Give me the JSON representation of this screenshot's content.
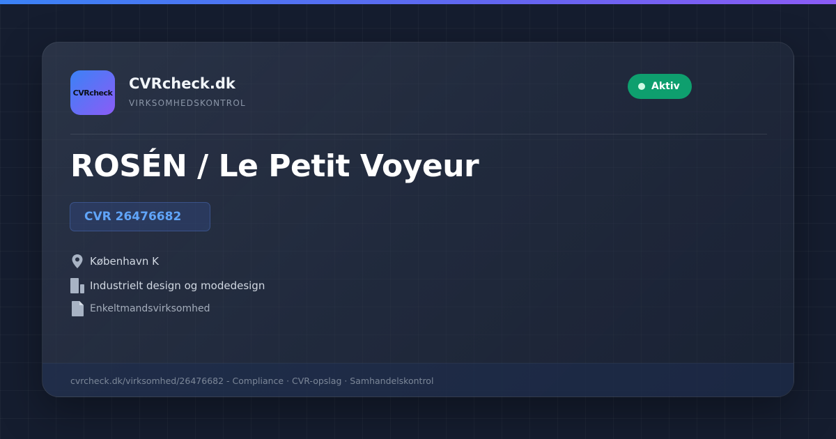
{
  "brand": {
    "logo_text": "CVRcheck",
    "name": "CVRcheck.dk",
    "subtitle": "VIRKSOMHEDSKONTROL"
  },
  "status": {
    "label": "Aktiv",
    "color": "#0e9f6e"
  },
  "company": {
    "name": "ROSÉN / Le Petit Voyeur",
    "cvr_label": "CVR 26476682"
  },
  "details": {
    "location": {
      "icon": "location-pin-icon",
      "text": "København K"
    },
    "industry": {
      "icon": "building-icon",
      "text": "Industrielt design og modedesign"
    },
    "company_type": {
      "icon": "document-icon",
      "text": "Enkeltmandsvirksomhed"
    }
  },
  "footer": {
    "text": "cvrcheck.dk/virksomhed/26476682 - Compliance · CVR-opslag · Samhandelskontrol"
  },
  "colors": {
    "accent_blue": "#3b82f6",
    "accent_purple": "#8b5cf6",
    "cvr_text": "#60a5fa",
    "background": "#151d2f"
  }
}
